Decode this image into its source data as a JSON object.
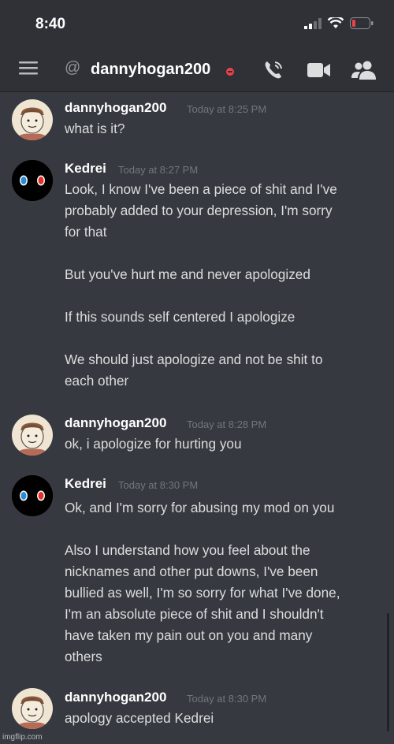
{
  "status_bar": {
    "time": "8:40",
    "battery_color": "#ed4245",
    "icons": [
      "signal-icon",
      "wifi-icon",
      "battery-icon"
    ]
  },
  "header": {
    "at_symbol": "@",
    "title": "dannyhogan200",
    "status": "do-not-disturb",
    "icons": [
      "menu-icon",
      "call-icon",
      "video-icon",
      "members-icon"
    ]
  },
  "messages": [
    {
      "author": "dannyhogan200",
      "timestamp": "Today at 8:25 PM",
      "lines": [
        "what is it?"
      ]
    },
    {
      "author": "Kedrei",
      "timestamp": "Today at 8:27 PM",
      "lines": [
        "Look, I know I've been a piece of shit and I've",
        "probably added to your depression, I'm sorry",
        "for that",
        "",
        "But you've hurt me and never apologized",
        "",
        "If this sounds self centered I apologize",
        "",
        "We should just apologize and not be shit to",
        "each other"
      ]
    },
    {
      "author": "dannyhogan200",
      "timestamp": "Today at 8:28 PM",
      "lines": [
        "ok, i apologize for hurting you"
      ]
    },
    {
      "author": "Kedrei",
      "timestamp": "Today at 8:30 PM",
      "lines": [
        "Ok, and I'm sorry for abusing my mod on you",
        "",
        "Also I understand how you feel about the",
        "nicknames and other put downs, I've been",
        "bullied as well, I'm so sorry for what I've done,",
        "I'm an absolute piece of shit and I shouldn't",
        "have taken my pain out on you and many",
        "others"
      ]
    },
    {
      "author": "dannyhogan200",
      "timestamp": "Today at 8:30 PM",
      "lines": [
        "apology accepted Kedrei"
      ]
    }
  ],
  "watermark": "imgflip.com"
}
